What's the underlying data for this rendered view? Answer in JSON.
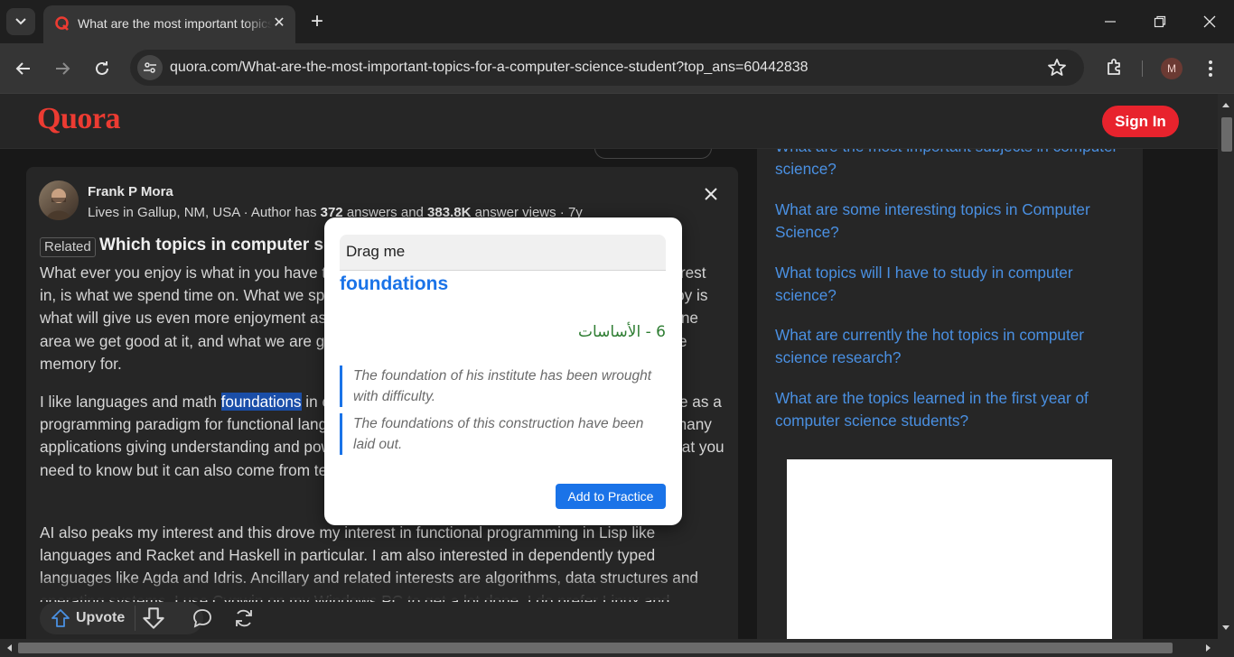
{
  "browser": {
    "tab_title": "What are the most important topics for a computer science student",
    "url": "quora.com/What-are-the-most-important-topics-for-a-computer-science-student?top_ans=60442838",
    "profile_initial": "M"
  },
  "header": {
    "logo": "Quora",
    "signin_label": "Sign In"
  },
  "answer": {
    "author_name": "Frank P Mora",
    "cred_prefix": "Lives in Gallup, NM, USA · Author has ",
    "cred_answers": "372",
    "cred_mid": " answers and ",
    "cred_views": "383.8K",
    "cred_suffix": " answer views · 7y",
    "related_tag": "Related",
    "related_question": "Which topics in computer science",
    "para1": "What ever you enjoy is what in you have the most interest in, and what we have the most interest in, is what we spend time on. What we spend time on is what we get good at, so what we enjoy is what will give us even more enjoyment as we get better at it and deeper. When we focus on one area we get good at it, and what we are good at reinforces our interest. It is also what we have memory for.",
    "para2_before": "I like languages and math ",
    "para2_highlight": "foundations",
    "para2_after": " in computer science, particularly type theory and its use as a programming paradigm for functional languages. Term rewriting is so broad and has so very many applications giving understanding and power in programming. Power comes from knowing what you need to know but it can also come from term rewriting.",
    "para3": "AI also peaks my interest and this drove my interest in functional programming in Lisp like languages and Racket and Haskell in particular. I am also interested in dependently typed languages like Agda and Idris. Ancillary and related interests are algorithms, data structures and operating systems. I use Cygwin on my Windows PC to get a lot done. I do prefer Linux and",
    "upvote_label": "Upvote"
  },
  "related_questions": [
    "What are the most important subjects in computer science?",
    "What are some interesting topics in Computer Science?",
    "What topics will I have to study in computer science?",
    "What are currently the hot topics in computer science research?",
    "What are the topics learned in the first year of computer science students?"
  ],
  "popup": {
    "drag_label": "Drag me",
    "word": "foundations",
    "translation": "6 - الأساسات",
    "examples": [
      "The foundation of his institute has been wrought with difficulty.",
      "The foundations of this construction have been laid out."
    ],
    "button_label": "Add to Practice"
  },
  "colors": {
    "quora_red": "#ec3b32",
    "signin_red": "#e8232d",
    "link_blue": "#4a90e2",
    "accent_blue": "#1a73e8",
    "translation_green": "#2e7d32"
  }
}
